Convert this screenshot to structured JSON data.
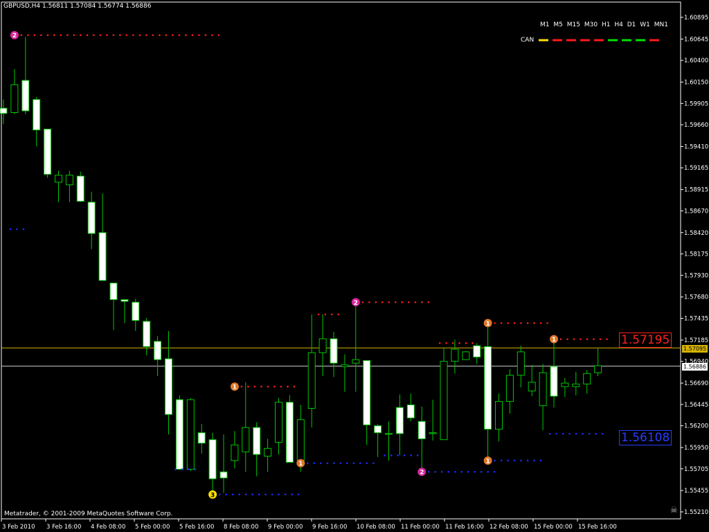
{
  "window": {
    "title": "GBPUSD,H4  1.56811 1.57084 1.56774 1.56886",
    "copyright": "Metatrader, © 2001-2009 MetaQuotes Software Corp."
  },
  "timeframes": {
    "labels": [
      "M1",
      "M5",
      "M15",
      "M30",
      "H1",
      "H4",
      "D1",
      "W1",
      "MN1"
    ],
    "row_label": "CAN",
    "colors": [
      "#ffe000",
      "#ff1a1a",
      "#ff1a1a",
      "#ff1a1a",
      "#ff1a1a",
      "#00e000",
      "#00e000",
      "#00e000",
      "#ff1a1a"
    ]
  },
  "price_tags": {
    "high": "1.57195",
    "low": "1.56108",
    "current_yellow": "1.57095",
    "current_white": "1.56886"
  },
  "colors": {
    "background": "#000000",
    "candle_bull": "#000000",
    "candle_bear": "#ffffff",
    "wick": "#00c800",
    "resistance_dots": "#ff1a1a",
    "support_dots": "#1a2cff",
    "axis": "#ffffff"
  },
  "chart_data": {
    "type": "candlestick",
    "symbol": "GBPUSD",
    "timeframe": "H4",
    "yticks": [
      1.60895,
      1.60645,
      1.604,
      1.6015,
      1.59905,
      1.5966,
      1.5941,
      1.59165,
      1.58915,
      1.5867,
      1.5842,
      1.58175,
      1.5793,
      1.5768,
      1.57435,
      1.57185,
      1.5694,
      1.5669,
      1.56445,
      1.562,
      1.5595,
      1.55705,
      1.55455,
      1.5521
    ],
    "ytick_labels": [
      "1.60895",
      "1.60645",
      "1.60400",
      "1.60150",
      "1.59905",
      "1.59660",
      "1.59410",
      "1.59165",
      "1.58915",
      "1.58670",
      "1.58420",
      "1.58175",
      "1.57930",
      "1.57680",
      "1.57435",
      "1.57185",
      "1.56940",
      "1.56690",
      "1.56445",
      "1.56200",
      "1.55950",
      "1.55705",
      "1.55455",
      "1.55210"
    ],
    "ylim": [
      1.5513,
      1.6107
    ],
    "xlabels": [
      "3 Feb 2010",
      "3 Feb 16:00",
      "4 Feb 08:00",
      "5 Feb 00:00",
      "5 Feb 16:00",
      "8 Feb 08:00",
      "9 Feb 00:00",
      "9 Feb 16:00",
      "10 Feb 08:00",
      "11 Feb 00:00",
      "11 Feb 16:00",
      "12 Feb 08:00",
      "15 Feb 00:00",
      "15 Feb 16:00"
    ],
    "horizontal_lines": [
      {
        "price": 1.57095,
        "color": "#d6b300"
      },
      {
        "price": 1.56886,
        "color": "#c8c8c8"
      }
    ],
    "candles": [
      [
        1.5985,
        1.5979,
        1.5995,
        1.5967
      ],
      [
        1.598,
        1.6012,
        1.603,
        1.5978
      ],
      [
        1.6017,
        1.5982,
        1.6067,
        1.5978
      ],
      [
        1.5995,
        1.596,
        1.5998,
        1.5941
      ],
      [
        1.5961,
        1.5909,
        1.5961,
        1.5905
      ],
      [
        1.59,
        1.5908,
        1.5913,
        1.5877
      ],
      [
        1.5897,
        1.5908,
        1.5913,
        1.5877
      ],
      [
        1.5907,
        1.5878,
        1.5912,
        1.5877
      ],
      [
        1.5877,
        1.5841,
        1.5889,
        1.5823
      ],
      [
        1.5842,
        1.5787,
        1.5887,
        1.5787
      ],
      [
        1.5784,
        1.5765,
        1.5784,
        1.573
      ],
      [
        1.5765,
        1.5763,
        1.5765,
        1.5738
      ],
      [
        1.5762,
        1.5741,
        1.5766,
        1.5729
      ],
      [
        1.574,
        1.5711,
        1.5744,
        1.5701
      ],
      [
        1.5717,
        1.5696,
        1.5723,
        1.5677
      ],
      [
        1.5697,
        1.5633,
        1.5729,
        1.561
      ],
      [
        1.565,
        1.557,
        1.5655,
        1.557
      ],
      [
        1.557,
        1.565,
        1.5652,
        1.5568
      ],
      [
        1.5612,
        1.56,
        1.5622,
        1.5588
      ],
      [
        1.5604,
        1.5559,
        1.5612,
        1.5541
      ],
      [
        1.5567,
        1.556,
        1.561,
        1.5543
      ],
      [
        1.558,
        1.5598,
        1.5614,
        1.5571
      ],
      [
        1.559,
        1.5618,
        1.567,
        1.5567
      ],
      [
        1.5618,
        1.5587,
        1.5624,
        1.5562
      ],
      [
        1.5585,
        1.5594,
        1.5605,
        1.5567
      ],
      [
        1.5601,
        1.5647,
        1.5652,
        1.5587
      ],
      [
        1.5647,
        1.5578,
        1.5655,
        1.5578
      ],
      [
        1.558,
        1.5627,
        1.5644,
        1.5567
      ],
      [
        1.564,
        1.5704,
        1.5748,
        1.5618
      ],
      [
        1.5704,
        1.572,
        1.5748,
        1.5677
      ],
      [
        1.572,
        1.5692,
        1.5728,
        1.5676
      ],
      [
        1.5688,
        1.569,
        1.5702,
        1.5659
      ],
      [
        1.5692,
        1.5696,
        1.5762,
        1.5659
      ],
      [
        1.5695,
        1.5621,
        1.5695,
        1.5598
      ],
      [
        1.562,
        1.5612,
        1.5622,
        1.5584
      ],
      [
        1.5611,
        1.5611,
        1.5625,
        1.558
      ],
      [
        1.5641,
        1.5611,
        1.5656,
        1.5586
      ],
      [
        1.5644,
        1.5629,
        1.5657,
        1.5625
      ],
      [
        1.5625,
        1.5605,
        1.5642,
        1.5566
      ],
      [
        1.5611,
        1.5612,
        1.565,
        1.5603
      ],
      [
        1.5604,
        1.5694,
        1.571,
        1.5604
      ],
      [
        1.5694,
        1.5708,
        1.5719,
        1.568
      ],
      [
        1.5696,
        1.5705,
        1.5706,
        1.5697
      ],
      [
        1.5712,
        1.5699,
        1.5715,
        1.5691
      ],
      [
        1.5711,
        1.5616,
        1.5736,
        1.558
      ],
      [
        1.5616,
        1.5648,
        1.5657,
        1.5602
      ],
      [
        1.5648,
        1.5678,
        1.5685,
        1.5634
      ],
      [
        1.5678,
        1.5705,
        1.5712,
        1.5664
      ],
      [
        1.566,
        1.567,
        1.569,
        1.5654
      ],
      [
        1.5643,
        1.5681,
        1.5691,
        1.5615
      ],
      [
        1.5688,
        1.5654,
        1.5718,
        1.5641
      ],
      [
        1.5665,
        1.5669,
        1.5675,
        1.5653
      ],
      [
        1.5665,
        1.5668,
        1.5682,
        1.5655
      ],
      [
        1.5668,
        1.568,
        1.5684,
        1.5657
      ],
      [
        1.5681,
        1.5689,
        1.5709,
        1.5677
      ]
    ],
    "resistance_levels": [
      {
        "price": 1.6069,
        "from_candle": 1,
        "to_candle": 20,
        "marker": "2",
        "marker_color": "#d6269a"
      },
      {
        "price": 1.5665,
        "from_candle": 21,
        "to_candle": 27,
        "marker": "1",
        "marker_color": "#e07828"
      },
      {
        "price": 1.5748,
        "from_candle": 28,
        "to_candle": 31
      },
      {
        "price": 1.5762,
        "from_candle": 32,
        "to_candle": 39,
        "marker": "2",
        "marker_color": "#d6269a"
      },
      {
        "price": 1.5715,
        "from_candle": 39,
        "to_candle": 43
      },
      {
        "price": 1.5738,
        "from_candle": 44,
        "to_candle": 50,
        "marker": "1",
        "marker_color": "#e07828"
      },
      {
        "price": 1.57195,
        "from_candle": 50,
        "to_candle": 55,
        "marker": "1",
        "marker_color": "#e07828"
      }
    ],
    "support_levels": [
      {
        "price": 1.5846,
        "from_candle": 0,
        "to_candle": 2
      },
      {
        "price": 1.557,
        "from_candle": 15,
        "to_candle": 18
      },
      {
        "price": 1.5541,
        "from_candle": 19,
        "to_candle": 27,
        "marker": "3",
        "marker_color": "#ffe000"
      },
      {
        "price": 1.5577,
        "from_candle": 27,
        "to_candle": 34,
        "marker": "1",
        "marker_color": "#e07828"
      },
      {
        "price": 1.5586,
        "from_candle": 34,
        "to_candle": 38
      },
      {
        "price": 1.5567,
        "from_candle": 38,
        "to_candle": 45,
        "marker": "2",
        "marker_color": "#d6269a"
      },
      {
        "price": 1.558,
        "from_candle": 44,
        "to_candle": 49,
        "marker": "1",
        "marker_color": "#e07828"
      },
      {
        "price": 1.56108,
        "from_candle": 49,
        "to_candle": 55
      }
    ]
  }
}
